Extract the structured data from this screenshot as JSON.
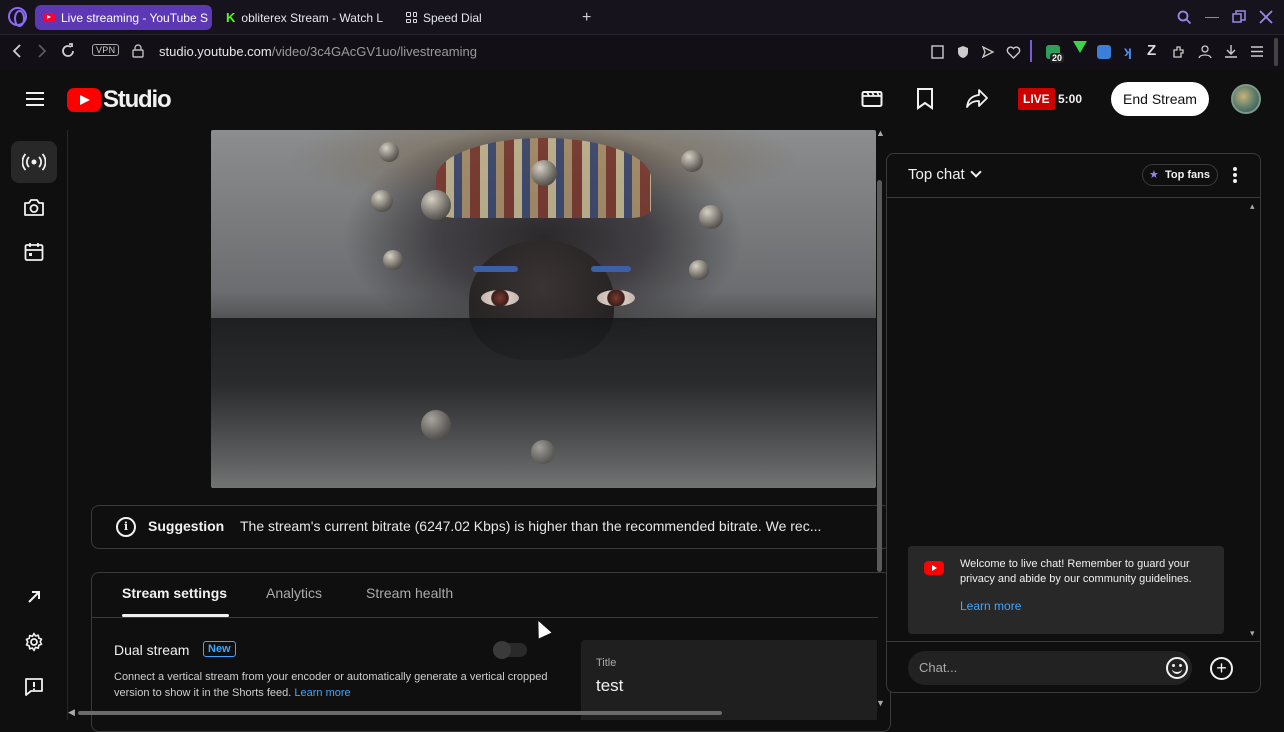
{
  "browser": {
    "tabs": [
      {
        "label": "Live streaming - YouTube S",
        "favicon": "youtube-icon",
        "active": true
      },
      {
        "label": "obliterex Stream - Watch L",
        "favicon": "kick-icon",
        "active": false
      },
      {
        "label": "Speed Dial",
        "favicon": "speed-dial-icon",
        "active": false
      }
    ],
    "new_tab_label": "+",
    "vpn_label": "VPN",
    "url_host": "studio.youtube.com",
    "url_path": "/video/3c4GAcGV1uo/livestreaming",
    "extension_badge": "20"
  },
  "header": {
    "logo_text": "Studio",
    "live_label": "LIVE",
    "live_time": "5:00",
    "end_stream_label": "End Stream"
  },
  "rail": {
    "items": [
      {
        "icon": "live-broadcast-icon",
        "active": true
      },
      {
        "icon": "camera-icon",
        "active": false
      },
      {
        "icon": "calendar-icon",
        "active": false
      }
    ],
    "bottom": [
      {
        "icon": "external-link-icon"
      },
      {
        "icon": "settings-icon"
      },
      {
        "icon": "feedback-icon"
      }
    ]
  },
  "suggestion": {
    "label": "Suggestion",
    "text": "The stream's current bitrate (6247.02 Kbps) is higher than the recommended bitrate. We rec..."
  },
  "settings": {
    "tabs": [
      {
        "label": "Stream settings",
        "active": true
      },
      {
        "label": "Analytics",
        "active": false
      },
      {
        "label": "Stream health",
        "active": false
      }
    ],
    "dual_stream": {
      "title": "Dual stream",
      "badge": "New",
      "enabled": false,
      "description": "Connect a vertical stream from your encoder or automatically generate a vertical cropped version to show it in the Shorts feed.",
      "learn_more": "Learn more"
    },
    "title_field": {
      "label": "Title",
      "value": "test"
    }
  },
  "chat": {
    "mode_label": "Top chat",
    "top_fans_label": "Top fans",
    "welcome_text": "Welcome to live chat! Remember to guard your privacy and abide by our community guidelines.",
    "welcome_learn_more": "Learn more",
    "input_placeholder": "Chat..."
  },
  "colors": {
    "accent_blue": "#3ea6ff",
    "live_red": "#cc0000",
    "opera_purple": "#5d38b4"
  }
}
